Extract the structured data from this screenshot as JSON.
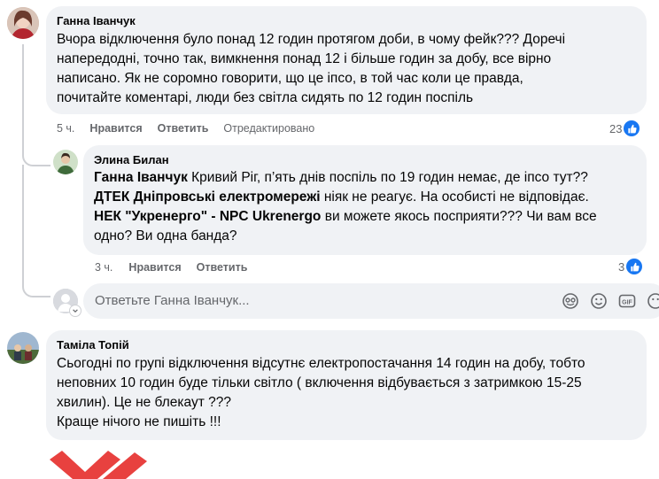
{
  "comment1": {
    "author": "Ганна Іванчук",
    "lines": [
      "Вчора відключення було понад 12 годин протягом доби, в чому фейк??? Доречі",
      "напередодні, точно так, вимкнення понад 12 і більше годин за добу, все вірно",
      "написано. Як не соромно говорити, що це іпсо, в той час коли це правда,",
      "почитайте коментарі, люди без світла сидять по 12 годин поспіль"
    ],
    "time": "5 ч.",
    "like_label": "Нравится",
    "reply_label": "Ответить",
    "edited_label": "Отредактировано",
    "reaction_count": "23"
  },
  "reply1": {
    "author": "Элина Билан",
    "line1_mention": "Ганна Іванчук",
    "line1_rest": " Кривий Ріг, п’ять днів поспіль по 19 годин немає, де іпсо тут??",
    "line2_mention": "ДТЕК Дніпровські електромережі",
    "line2_rest": " ніяк не реагує. На особисті не відповідає.",
    "line3_mention": "НЕК \"Укренерго\" - NPC Ukrenergo",
    "line3_rest": " ви можете якось посприяти??? Чи вам все",
    "line4": "одно? Ви одна банда?",
    "time": "3 ч.",
    "like_label": "Нравится",
    "reply_label": "Ответить",
    "reaction_count": "3"
  },
  "reply_input": {
    "placeholder": "Ответьте Ганна Іванчук..."
  },
  "comment2": {
    "author": "Таміла Топій",
    "lines": [
      "Сьогодні по групі відключення відсутнє електропостачання 14 годин на добу, тобто",
      "неповних 10 годин буде тільки світло ( включення відбувається з затримкою 15-25",
      "хвилин). Це не блекаут ???",
      "Краще нічого не пишіть !!!"
    ]
  },
  "colors": {
    "bubble": "#f0f2f5",
    "like_blue": "#1877f2",
    "meta_gray": "#65676b",
    "reaction_red": "#e8413f"
  }
}
